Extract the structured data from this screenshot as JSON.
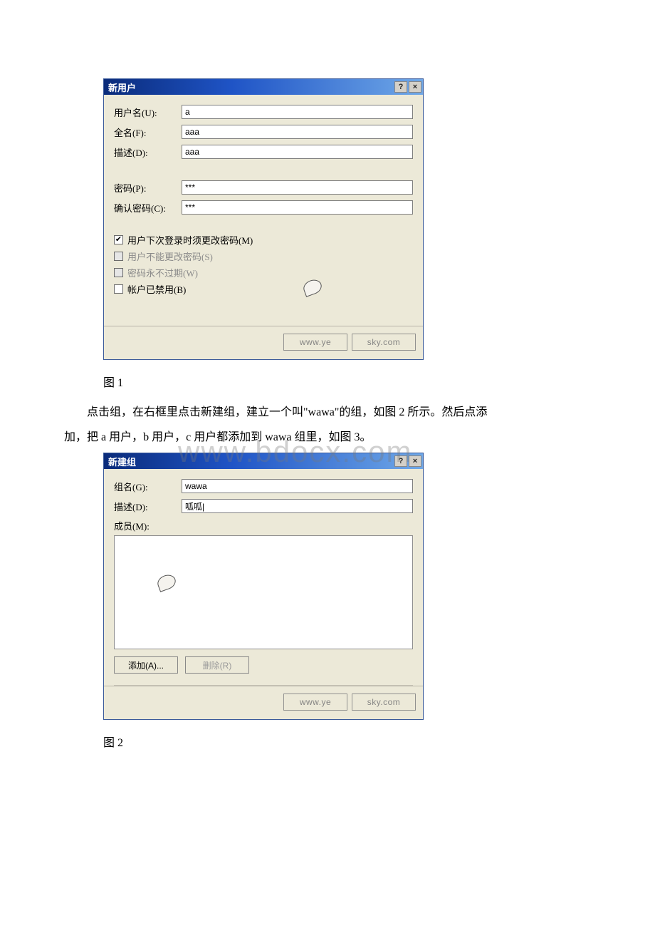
{
  "watermark_big": "www.bdocx.com",
  "dialog1": {
    "title": "新用户",
    "help_glyph": "?",
    "close_glyph": "×",
    "fields": {
      "username_label": "用户名(U):",
      "username_value": "a",
      "fullname_label": "全名(F):",
      "fullname_value": "aaa",
      "desc_label": "描述(D):",
      "desc_value": "aaa",
      "pwd_label": "密码(P):",
      "pwd_value": "***",
      "confirm_label": "确认密码(C):",
      "confirm_value": "***"
    },
    "checks": {
      "c1_label": "用户下次登录时须更改密码(M)",
      "c1_checked": "✔",
      "c2_label": "用户不能更改密码(S)",
      "c3_label": "密码永不过期(W)",
      "c4_label": "帐户已禁用(B)"
    },
    "footer_wm1": "www.ye",
    "footer_wm2": "sky.com"
  },
  "caption1": "图 1",
  "paragraph1a": "点击组，在右框里点击新建组，建立一个叫\"wawa\"的组，如图 2 所示。然后点添",
  "paragraph1b": "加，把 a 用户，b 用户，c 用户都添加到 wawa 组里，如图 3。",
  "dialog2": {
    "title": "新建组",
    "help_glyph": "?",
    "close_glyph": "×",
    "fields": {
      "groupname_label": "组名(G):",
      "groupname_value": "wawa",
      "desc_label": "描述(D):",
      "desc_value": "呱呱|",
      "members_label": "成员(M):"
    },
    "buttons": {
      "add": "添加(A)...",
      "remove": "删除(R)"
    },
    "footer_wm1": "www.ye",
    "footer_wm2": "sky.com"
  },
  "caption2": "图 2"
}
